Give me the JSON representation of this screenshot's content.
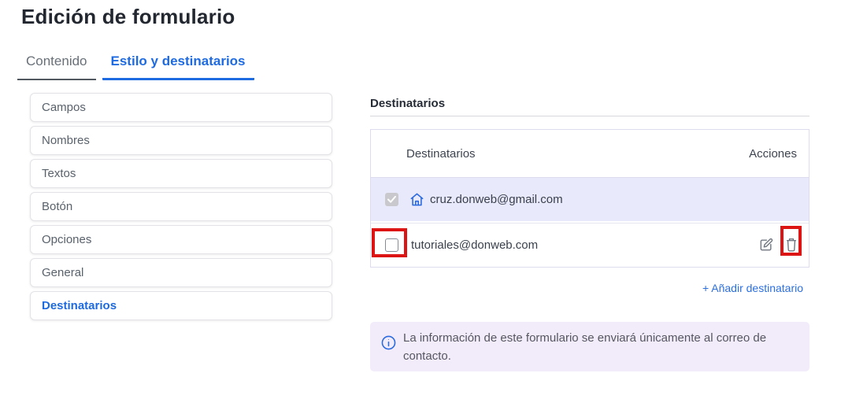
{
  "page": {
    "title": "Edición de formulario"
  },
  "tabs": [
    {
      "label": "Contenido",
      "active": false
    },
    {
      "label": "Estilo y destinatarios",
      "active": true
    }
  ],
  "sidebar": {
    "items": [
      {
        "label": "Campos",
        "active": false
      },
      {
        "label": "Nombres",
        "active": false
      },
      {
        "label": "Textos",
        "active": false
      },
      {
        "label": "Botón",
        "active": false
      },
      {
        "label": "Opciones",
        "active": false
      },
      {
        "label": "General",
        "active": false
      },
      {
        "label": "Destinatarios",
        "active": true
      }
    ]
  },
  "recipients": {
    "section_title": "Destinatarios",
    "table": {
      "headers": {
        "recipient": "Destinatarios",
        "actions": "Acciones"
      },
      "rows": [
        {
          "email": "cruz.donweb@gmail.com",
          "checked": true,
          "checkbox_disabled": true,
          "is_contact_address": true
        },
        {
          "email": "tutoriales@donweb.com",
          "checked": false,
          "checkbox_disabled": false,
          "is_contact_address": false
        }
      ]
    },
    "add_link": "+ Añadir destinatario",
    "info_message": "La información de este formulario se enviará únicamente al correo de contacto."
  },
  "icons": {
    "home": "home-icon",
    "edit": "edit-icon",
    "delete": "trash-icon",
    "info": "info-icon",
    "check": "check-icon"
  },
  "colors": {
    "accent_blue": "#1e6ae0",
    "annotation_red": "#dc1414",
    "row_highlight": "#e8e9fb",
    "info_background": "#f2ecfa",
    "disabled_checkbox": "#c9c9cd"
  }
}
